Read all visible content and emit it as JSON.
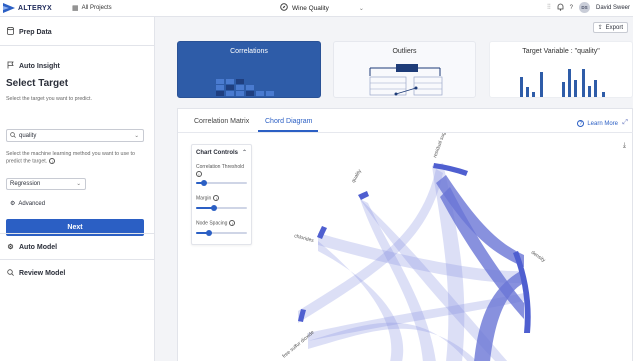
{
  "topbar": {
    "brand": "ALTERYX",
    "all_projects": "All Projects",
    "project_title": "Wine Quality",
    "user_initials": "DS",
    "user_name": "David Sweer"
  },
  "sidebar": {
    "prep_data": "Prep Data",
    "auto_insight": "Auto Insight",
    "select_target_title": "Select Target",
    "select_target_help": "Select the target you want to predict.",
    "target_value": "quality",
    "method_help": "Select the machine learning method you want to use to predict the target.",
    "method_value": "Regression",
    "advanced": "Advanced",
    "next_button": "Next",
    "auto_model": "Auto Model",
    "review_model": "Review Model"
  },
  "main": {
    "export_label": "Export",
    "cards": [
      {
        "label": "Correlations"
      },
      {
        "label": "Outliers"
      },
      {
        "label": "Target Variable : \"quality\""
      }
    ],
    "tabs": [
      {
        "label": "Correlation Matrix"
      },
      {
        "label": "Chord Diagram"
      }
    ],
    "learn_more": "Learn More",
    "chart_controls": {
      "title": "Chart Controls",
      "correlation_threshold": "Correlation Threshold",
      "correlation_threshold_value": 0.15,
      "margin": "Margin",
      "margin_value": 0.35,
      "node_spacing": "Node Spacing",
      "node_spacing_value": 0.25
    }
  },
  "chord_labels": {
    "residual_sugar": "residual sugar",
    "quality": "quality",
    "chlorides": "chlorides",
    "density": "density",
    "free_sulfur_dioxide": "free sulfur dioxide"
  },
  "colors": {
    "accent": "#2b5fc4",
    "card_active": "#2e5ca8",
    "chord_node": "#4f5fd0",
    "chord_ribbon": "#8b95e0"
  }
}
